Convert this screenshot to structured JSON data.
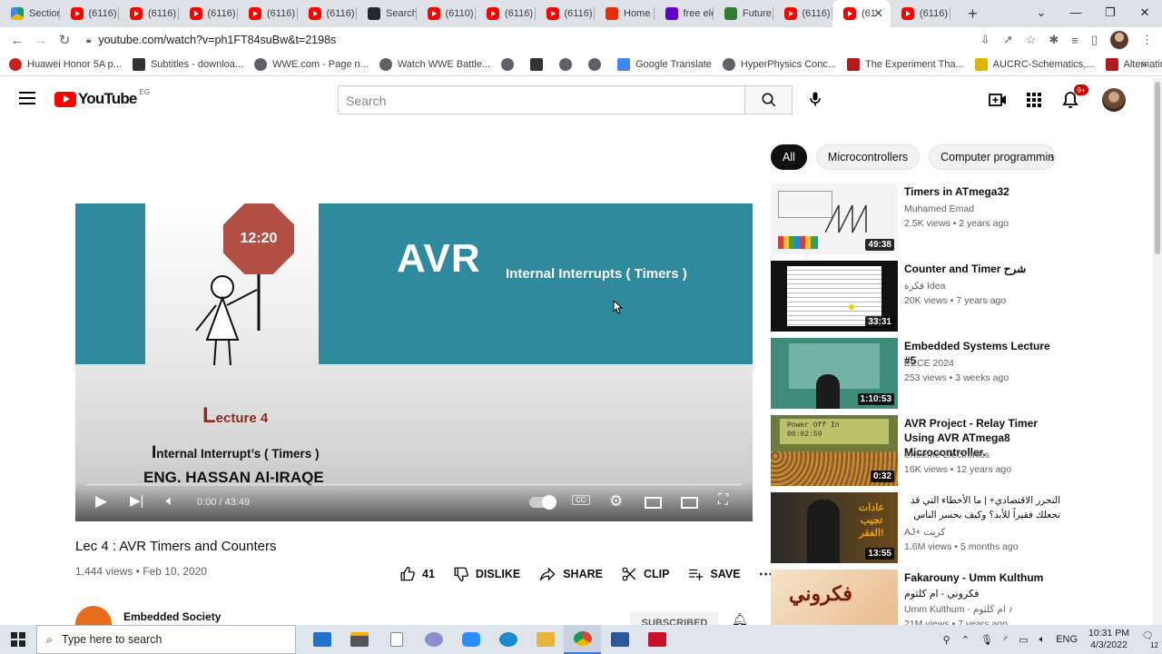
{
  "browser": {
    "tabs": [
      {
        "label": "Section",
        "icon": "google-drive-icon"
      },
      {
        "label": "(6116)",
        "icon": "youtube-icon"
      },
      {
        "label": "(6116)",
        "icon": "youtube-icon"
      },
      {
        "label": "(6116)",
        "icon": "youtube-icon"
      },
      {
        "label": "(6116)",
        "icon": "youtube-icon"
      },
      {
        "label": "(6116)",
        "icon": "youtube-icon"
      },
      {
        "label": "Search",
        "icon": "github-icon"
      },
      {
        "label": "(6110)",
        "icon": "youtube-icon"
      },
      {
        "label": "(6116)",
        "icon": "youtube-icon"
      },
      {
        "label": "(6116)",
        "icon": "youtube-icon"
      },
      {
        "label": "Home",
        "icon": "aliexpress-icon"
      },
      {
        "label": "free ele",
        "icon": "yahoo-icon"
      },
      {
        "label": "Future",
        "icon": "future-icon"
      },
      {
        "label": "(6116)",
        "icon": "youtube-icon"
      },
      {
        "label": "(61",
        "icon": "youtube-icon",
        "active": true
      },
      {
        "label": "(6116)",
        "icon": "youtube-icon"
      }
    ],
    "url": "youtube.com/watch?v=ph1FT84suBw&t=2198s",
    "bookmarks": [
      {
        "label": "Huawei Honor 5A p...",
        "icon": "huawei-icon"
      },
      {
        "label": "Subtitles - downloa...",
        "icon": "subtitles-icon"
      },
      {
        "label": "WWE.com - Page n...",
        "icon": "globe-icon"
      },
      {
        "label": "Watch WWE Battle...",
        "icon": "globe-icon"
      },
      {
        "label": "",
        "icon": "globe-icon"
      },
      {
        "label": "",
        "icon": "image-icon"
      },
      {
        "label": "",
        "icon": "globe-icon"
      },
      {
        "label": "",
        "icon": "globe-icon"
      },
      {
        "label": "Google Translate",
        "icon": "translate-icon"
      },
      {
        "label": "HyperPhysics Conc...",
        "icon": "globe-icon"
      },
      {
        "label": "The Experiment Tha...",
        "icon": "x-icon"
      },
      {
        "label": "AUCRC-Schematics,...",
        "icon": "aucrc-icon"
      },
      {
        "label": "Alternating & Direc...",
        "icon": "book-icon"
      }
    ]
  },
  "youtube": {
    "logo_text": "YouTube",
    "country_code": "EG",
    "search_placeholder": "Search",
    "notifications": "9+",
    "video": {
      "slide": {
        "clock": "12:20",
        "headline": "AVR",
        "subheadline": "Internal Interrupts ( Timers )",
        "lecture_cap": "L",
        "lecture_rest": "ecture 4",
        "topic_cap": "I",
        "topic_rest": "nternal  Interrupt’s ( Timers )",
        "presenter": "ENG. HASSAN Al-IRAQE"
      },
      "time": "0:00 / 43:49",
      "progress": 0.0,
      "title": "Lec 4 : AVR Timers and Counters",
      "views_date": "1,444 views • Feb 10, 2020",
      "likes": "41",
      "dislike_label": "DISLIKE",
      "share_label": "SHARE",
      "clip_label": "CLIP",
      "save_label": "SAVE",
      "channel": "Embedded Society",
      "subscribe_label": "SUBSCRIBED"
    },
    "chips": [
      "All",
      "Microcontrollers",
      "Computer programmin"
    ],
    "recommendations": [
      {
        "title": "Timers in ATmega32",
        "channel": "Muhamed Emad",
        "meta": "2.5K views • 2 years ago",
        "duration": "49:38",
        "theme": "whiteboard"
      },
      {
        "title": "Counter and Timer شرح",
        "channel": "فكرة Idea",
        "meta": "20K views • 7 years ago",
        "duration": "33:31",
        "theme": "document"
      },
      {
        "title": "Embedded Systems Lecture #5",
        "channel": "EECE 2024",
        "meta": "253 views • 3 weeks ago",
        "duration": "1:10:53",
        "theme": "lecture"
      },
      {
        "title": "AVR Project - Relay Timer Using AVR ATmega8 Microcontroller.",
        "channel": "eXtreme Electronics",
        "meta": "16K views • 12 years ago",
        "duration": "0:32",
        "theme": "lcd",
        "lcd_line1": "Power Off In",
        "lcd_line2": "00:02:59"
      },
      {
        "title": "التحرر الاقتصادي+ | ما الأخطاء التي قد تجعلك فقيراً للأبد؟ وكيف بحسر الناس",
        "channel": "AJ+ كريت",
        "meta": "1.6M views • 5 months ago",
        "duration": "13:55",
        "theme": "ajplus",
        "thumb_text": "عادات تجيب الفقر!"
      },
      {
        "title": "Fakarouny - Umm Kulthum",
        "subtitle": "فكروني - ام كلثوم",
        "channel": "Umm Kulthum - ام كلثوم ♪",
        "meta": "21M views • 7 years ago",
        "duration": "",
        "theme": "calligraphy",
        "thumb_text": "فكروني"
      }
    ]
  },
  "taskbar": {
    "search_placeholder": "Type here to search",
    "language": "ENG",
    "time": "10:31 PM",
    "date": "4/3/2022",
    "notifications": "12"
  },
  "colors": {
    "youtube_red": "#ff0000",
    "slide_teal": "#2e8a9c",
    "stop_sign": "#b14f45"
  }
}
